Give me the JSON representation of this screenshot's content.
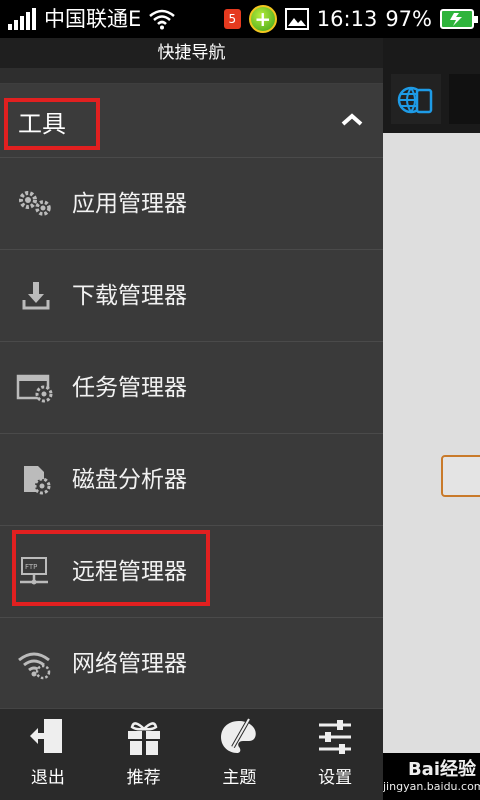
{
  "status_bar": {
    "carrier": "中国联通",
    "network_type": "E",
    "notification_count": "5",
    "time": "16:13",
    "battery_percent": "97%",
    "battery_level": 0.97
  },
  "drawer": {
    "title": "快捷导航",
    "section_title": "工具",
    "items": [
      {
        "label": "应用管理器",
        "icon": "gears-app-icon"
      },
      {
        "label": "下载管理器",
        "icon": "download-icon"
      },
      {
        "label": "任务管理器",
        "icon": "task-icon"
      },
      {
        "label": "磁盘分析器",
        "icon": "sdcard-icon"
      },
      {
        "label": "远程管理器",
        "icon": "ftp-icon"
      },
      {
        "label": "网络管理器",
        "icon": "wifi-network-icon"
      }
    ]
  },
  "bottom_nav": {
    "exit": "退出",
    "recommend": "推荐",
    "theme": "主题",
    "settings": "设置"
  },
  "watermark": {
    "line1": "Bai",
    "line1b": "经验",
    "line2": "jingyan.baidu.com"
  },
  "colors": {
    "highlight_red": "#e12020",
    "accent_blue": "#1e9be6",
    "battery_green": "#2fb43c"
  }
}
